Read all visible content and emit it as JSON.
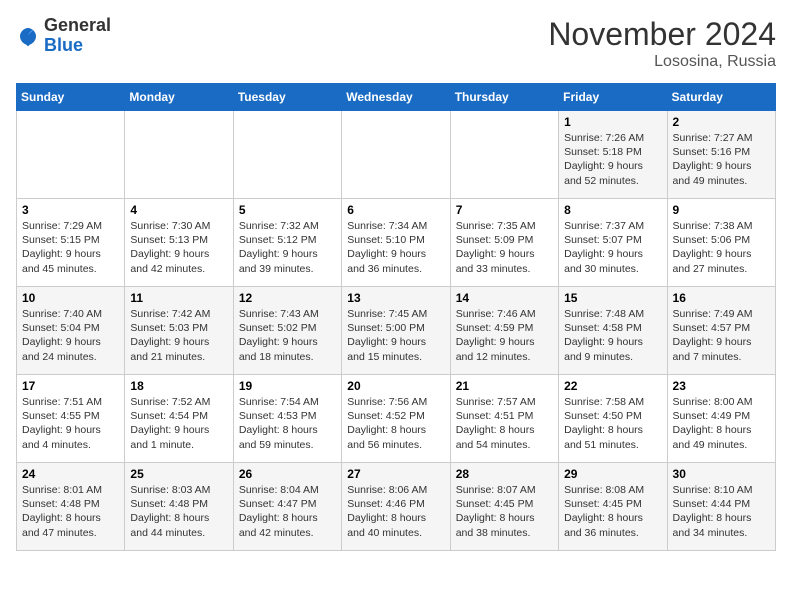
{
  "header": {
    "logo": {
      "general": "General",
      "blue": "Blue"
    },
    "title": "November 2024",
    "location": "Lososina, Russia"
  },
  "calendar": {
    "days_of_week": [
      "Sunday",
      "Monday",
      "Tuesday",
      "Wednesday",
      "Thursday",
      "Friday",
      "Saturday"
    ],
    "weeks": [
      [
        {
          "day": "",
          "info": ""
        },
        {
          "day": "",
          "info": ""
        },
        {
          "day": "",
          "info": ""
        },
        {
          "day": "",
          "info": ""
        },
        {
          "day": "",
          "info": ""
        },
        {
          "day": "1",
          "info": "Sunrise: 7:26 AM\nSunset: 5:18 PM\nDaylight: 9 hours and 52 minutes."
        },
        {
          "day": "2",
          "info": "Sunrise: 7:27 AM\nSunset: 5:16 PM\nDaylight: 9 hours and 49 minutes."
        }
      ],
      [
        {
          "day": "3",
          "info": "Sunrise: 7:29 AM\nSunset: 5:15 PM\nDaylight: 9 hours and 45 minutes."
        },
        {
          "day": "4",
          "info": "Sunrise: 7:30 AM\nSunset: 5:13 PM\nDaylight: 9 hours and 42 minutes."
        },
        {
          "day": "5",
          "info": "Sunrise: 7:32 AM\nSunset: 5:12 PM\nDaylight: 9 hours and 39 minutes."
        },
        {
          "day": "6",
          "info": "Sunrise: 7:34 AM\nSunset: 5:10 PM\nDaylight: 9 hours and 36 minutes."
        },
        {
          "day": "7",
          "info": "Sunrise: 7:35 AM\nSunset: 5:09 PM\nDaylight: 9 hours and 33 minutes."
        },
        {
          "day": "8",
          "info": "Sunrise: 7:37 AM\nSunset: 5:07 PM\nDaylight: 9 hours and 30 minutes."
        },
        {
          "day": "9",
          "info": "Sunrise: 7:38 AM\nSunset: 5:06 PM\nDaylight: 9 hours and 27 minutes."
        }
      ],
      [
        {
          "day": "10",
          "info": "Sunrise: 7:40 AM\nSunset: 5:04 PM\nDaylight: 9 hours and 24 minutes."
        },
        {
          "day": "11",
          "info": "Sunrise: 7:42 AM\nSunset: 5:03 PM\nDaylight: 9 hours and 21 minutes."
        },
        {
          "day": "12",
          "info": "Sunrise: 7:43 AM\nSunset: 5:02 PM\nDaylight: 9 hours and 18 minutes."
        },
        {
          "day": "13",
          "info": "Sunrise: 7:45 AM\nSunset: 5:00 PM\nDaylight: 9 hours and 15 minutes."
        },
        {
          "day": "14",
          "info": "Sunrise: 7:46 AM\nSunset: 4:59 PM\nDaylight: 9 hours and 12 minutes."
        },
        {
          "day": "15",
          "info": "Sunrise: 7:48 AM\nSunset: 4:58 PM\nDaylight: 9 hours and 9 minutes."
        },
        {
          "day": "16",
          "info": "Sunrise: 7:49 AM\nSunset: 4:57 PM\nDaylight: 9 hours and 7 minutes."
        }
      ],
      [
        {
          "day": "17",
          "info": "Sunrise: 7:51 AM\nSunset: 4:55 PM\nDaylight: 9 hours and 4 minutes."
        },
        {
          "day": "18",
          "info": "Sunrise: 7:52 AM\nSunset: 4:54 PM\nDaylight: 9 hours and 1 minute."
        },
        {
          "day": "19",
          "info": "Sunrise: 7:54 AM\nSunset: 4:53 PM\nDaylight: 8 hours and 59 minutes."
        },
        {
          "day": "20",
          "info": "Sunrise: 7:56 AM\nSunset: 4:52 PM\nDaylight: 8 hours and 56 minutes."
        },
        {
          "day": "21",
          "info": "Sunrise: 7:57 AM\nSunset: 4:51 PM\nDaylight: 8 hours and 54 minutes."
        },
        {
          "day": "22",
          "info": "Sunrise: 7:58 AM\nSunset: 4:50 PM\nDaylight: 8 hours and 51 minutes."
        },
        {
          "day": "23",
          "info": "Sunrise: 8:00 AM\nSunset: 4:49 PM\nDaylight: 8 hours and 49 minutes."
        }
      ],
      [
        {
          "day": "24",
          "info": "Sunrise: 8:01 AM\nSunset: 4:48 PM\nDaylight: 8 hours and 47 minutes."
        },
        {
          "day": "25",
          "info": "Sunrise: 8:03 AM\nSunset: 4:48 PM\nDaylight: 8 hours and 44 minutes."
        },
        {
          "day": "26",
          "info": "Sunrise: 8:04 AM\nSunset: 4:47 PM\nDaylight: 8 hours and 42 minutes."
        },
        {
          "day": "27",
          "info": "Sunrise: 8:06 AM\nSunset: 4:46 PM\nDaylight: 8 hours and 40 minutes."
        },
        {
          "day": "28",
          "info": "Sunrise: 8:07 AM\nSunset: 4:45 PM\nDaylight: 8 hours and 38 minutes."
        },
        {
          "day": "29",
          "info": "Sunrise: 8:08 AM\nSunset: 4:45 PM\nDaylight: 8 hours and 36 minutes."
        },
        {
          "day": "30",
          "info": "Sunrise: 8:10 AM\nSunset: 4:44 PM\nDaylight: 8 hours and 34 minutes."
        }
      ]
    ]
  }
}
